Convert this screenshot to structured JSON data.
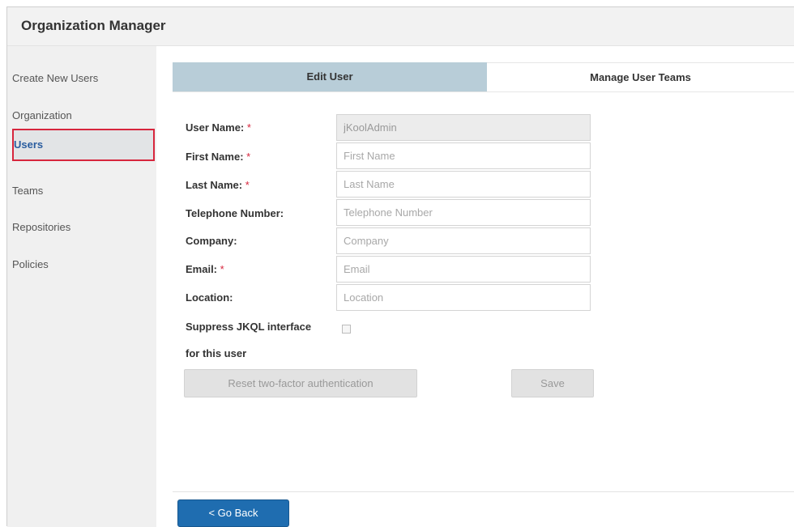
{
  "app": {
    "title": "Organization Manager"
  },
  "sidebar": {
    "items": [
      {
        "label": "Create New Users"
      },
      {
        "label": "Organization"
      },
      {
        "label": "Users"
      },
      {
        "label": "Teams"
      },
      {
        "label": "Repositories"
      },
      {
        "label": "Policies"
      }
    ]
  },
  "tabs": [
    {
      "label": "Edit User"
    },
    {
      "label": "Manage User Teams"
    }
  ],
  "form": {
    "required_marker": "*",
    "user_name": {
      "label": "User Name:",
      "value": "jKoolAdmin"
    },
    "first_name": {
      "label": "First Name:",
      "placeholder": "First Name",
      "value": ""
    },
    "last_name": {
      "label": "Last Name:",
      "placeholder": "Last Name",
      "value": ""
    },
    "telephone": {
      "label": "Telephone Number:",
      "placeholder": "Telephone Number",
      "value": ""
    },
    "company": {
      "label": "Company:",
      "placeholder": "Company",
      "value": ""
    },
    "email": {
      "label": "Email:",
      "placeholder": "Email",
      "value": ""
    },
    "location": {
      "label": "Location:",
      "placeholder": "Location",
      "value": ""
    },
    "suppress": {
      "label_line1": "Suppress JKQL interface",
      "label_line2": "for this user",
      "checked": false
    }
  },
  "buttons": {
    "reset_2fa": "Reset two-factor authentication",
    "save": "Save",
    "go_back": "< Go Back"
  },
  "colors": {
    "active_tab": "#b8cdd8",
    "primary_button": "#1f6db0",
    "required": "#d7263d",
    "selected_outline": "#d7263d"
  }
}
